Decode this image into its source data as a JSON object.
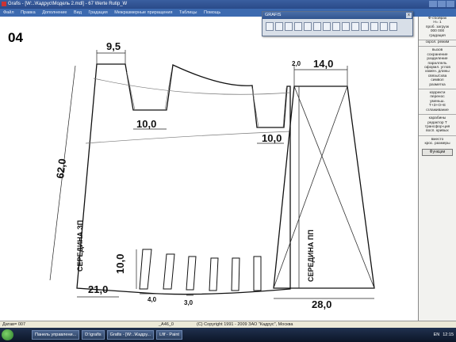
{
  "window": {
    "title": "Grafis - [W:..\\Кадрус\\Модель 2.mdl] - 67 Werte Rutip_W"
  },
  "menu": {
    "items": [
      "Файл",
      "Правка",
      "Дополнение",
      "Вид",
      "Градация",
      "Межразмерные приращения",
      "Таблицы",
      "Помощь"
    ]
  },
  "grafis_toolbar": {
    "title": "GRAFIS",
    "close_label": "x"
  },
  "drawing": {
    "page_number": "04",
    "dim_top_width": "9,5",
    "dim_dart_left": "10,0",
    "dim_dart_right": "10,0",
    "dim_height": "62,0",
    "dim_top_right_small": "2,0",
    "dim_top_right": "14,0",
    "dim_pleat_height": "10,0",
    "dim_bottom_left": "21,0",
    "dim_pleat_width": "4,0",
    "dim_pleat_gap": "3,0",
    "dim_bottom_right": "28,0",
    "label_back_center": "СЕРЕДИНА ЗП",
    "label_front_center": "СЕРЕДИНА ПП"
  },
  "side_panel": {
    "top_items": [
      "Ф-сбойрак",
      "Н=  1",
      "проб. загрузк",
      "000  000",
      "градация"
    ],
    "group2": [
      "скрол. режим"
    ],
    "group3": [
      "вызов",
      "сохранение",
      "разделение",
      "параллель",
      "оформл. углов",
      "измен. длины",
      "связь/схва",
      "символ",
      "разметка"
    ],
    "group4": [
      "корректи",
      "перенос",
      "уменьш.",
      "Т+З+О+Е",
      "сглаживание"
    ],
    "group5": [
      "карабины",
      "редактор Т",
      "трансфор-ция",
      "восп. кривых"
    ],
    "group6": [
      "вместо",
      "крос. размеры"
    ],
    "button_label": "Функции"
  },
  "status": {
    "left": "Датав= 007",
    "mid": "_А46_0",
    "copyright": "(C) Copyright 1991 - 2009 ЗАО \"Кадрус\", Москва"
  },
  "taskbar": {
    "tasks": [
      "Панель управлени...",
      "D:\\grafis",
      "Grafis - [W:..\\Кадру...",
      "Lfif - Paint"
    ],
    "lang": "EN",
    "time": "12:15"
  }
}
